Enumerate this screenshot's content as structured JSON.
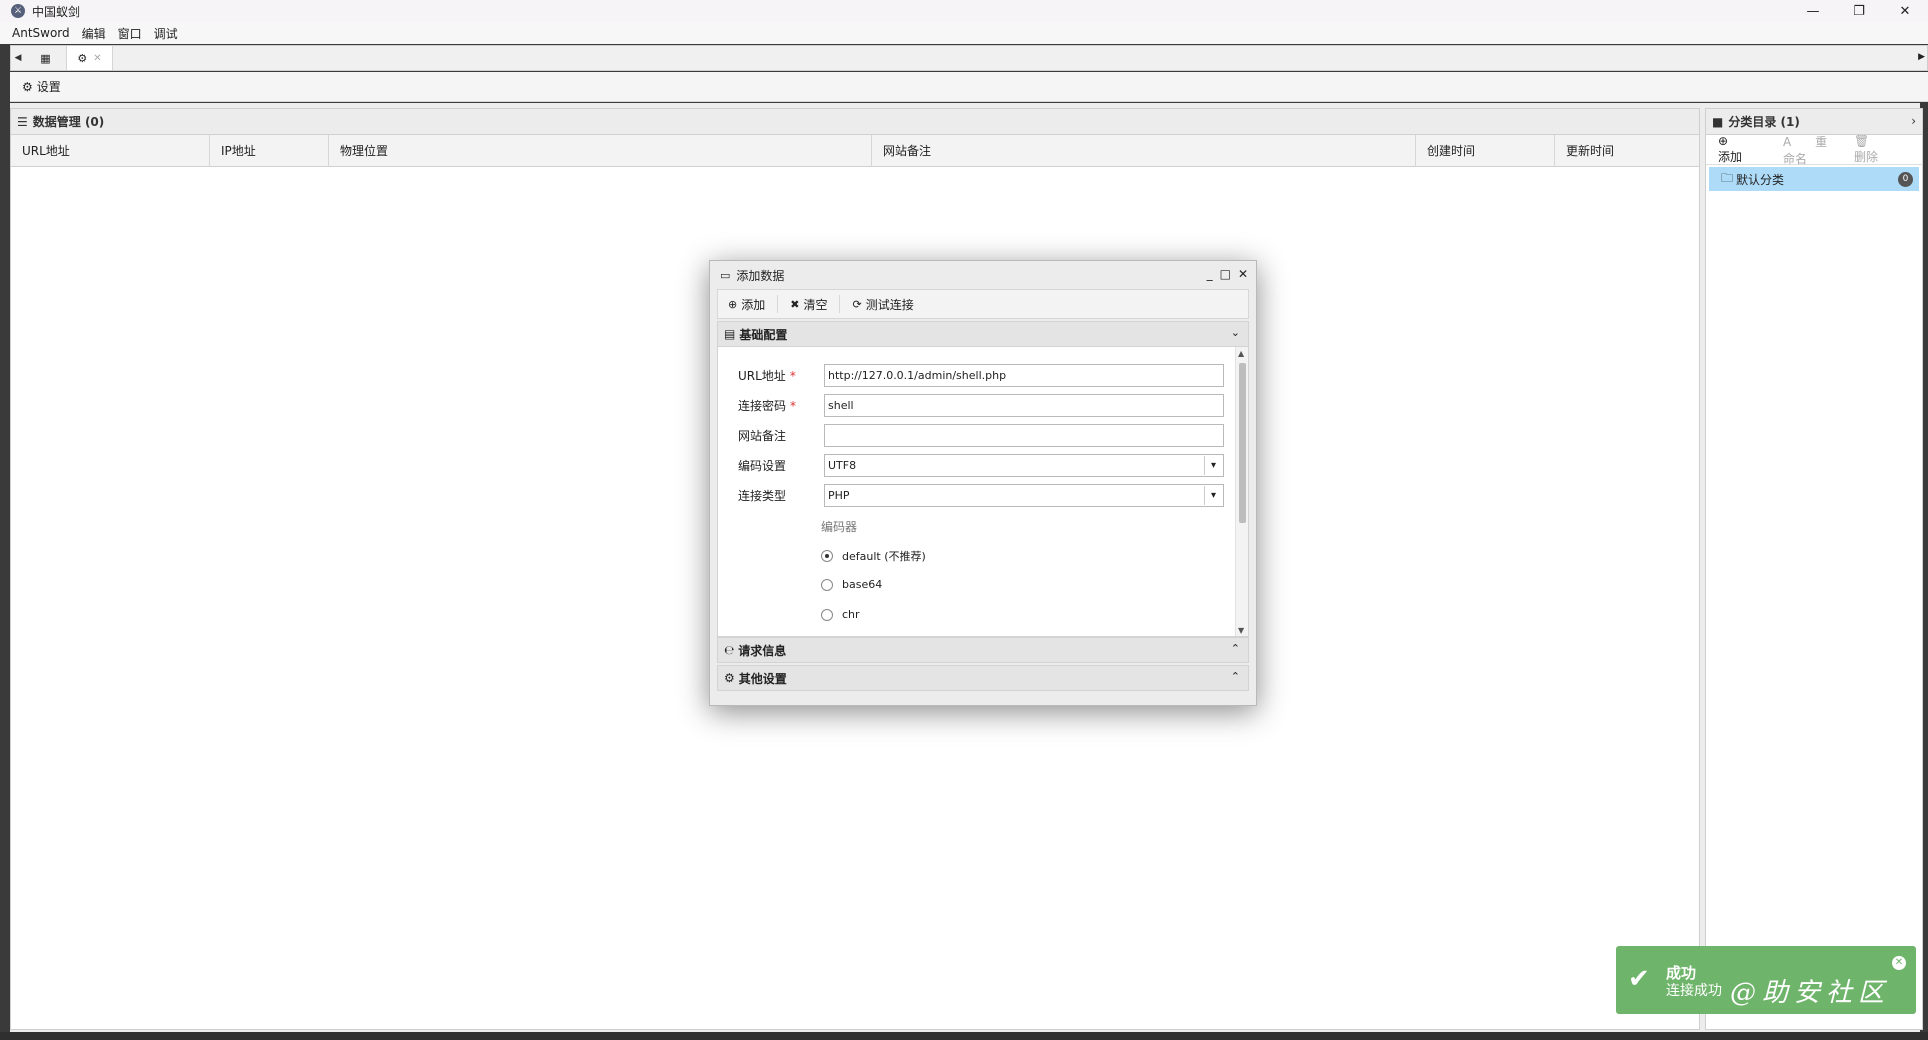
{
  "window": {
    "title": "中国蚁剑",
    "logo_char": "⚔"
  },
  "window_controls": {
    "minimize": "—",
    "maximize": "❐",
    "close": "✕"
  },
  "menu": {
    "items": [
      "AntSword",
      "编辑",
      "窗口",
      "调试"
    ]
  },
  "tabs": {
    "left_arrow": "◀",
    "right_arrow": "▶",
    "home_icon": "▦",
    "settings_icon": "⚙",
    "close": "✕"
  },
  "settings_bar": {
    "icon": "⚙",
    "label": "设置"
  },
  "data_panel": {
    "icon": "☰",
    "title": "数据管理 (0)",
    "columns": [
      "URL地址",
      "IP地址",
      "物理位置",
      "网站备注",
      "创建时间",
      "更新时间"
    ]
  },
  "category_panel": {
    "icon": "■",
    "title": "分类目录 (1)",
    "collapse": "›",
    "toolbar": {
      "add_icon": "⊕",
      "add": "添加",
      "rename_icon": "A",
      "rename": "重命名",
      "delete_icon": "🗑",
      "delete": "删除"
    },
    "items": [
      {
        "icon": "🗀",
        "label": "默认分类",
        "count": "0"
      }
    ]
  },
  "dialog": {
    "icon": "▭",
    "title": "添加数据",
    "controls": {
      "minimize": "_",
      "maximize": "□",
      "close": "✕"
    },
    "toolbar": {
      "add_icon": "⊕",
      "add": "添加",
      "clear_icon": "✖",
      "clear": "清空",
      "test_icon": "⟳",
      "test": "测试连接"
    },
    "sections": {
      "basic": {
        "icon": "▤",
        "title": "基础配置",
        "arrow": "⌄"
      },
      "request": {
        "icon": "℮",
        "title": "请求信息",
        "arrow": "⌃"
      },
      "other": {
        "icon": "⚙",
        "title": "其他设置",
        "arrow": "⌃"
      }
    },
    "form": {
      "url": {
        "label": "URL地址",
        "required": "*",
        "value": "http://127.0.0.1/admin/shell.php"
      },
      "password": {
        "label": "连接密码",
        "required": "*",
        "value": "shell"
      },
      "note": {
        "label": "网站备注",
        "value": ""
      },
      "encoding": {
        "label": "编码设置",
        "value": "UTF8",
        "dropdown": "▾"
      },
      "type": {
        "label": "连接类型",
        "value": "PHP",
        "dropdown": "▾"
      },
      "encoder_label": "编码器",
      "encoders": [
        {
          "label": "default (不推荐)",
          "checked": true
        },
        {
          "label": "base64",
          "checked": false
        },
        {
          "label": "chr",
          "checked": false
        }
      ]
    },
    "scroll": {
      "up": "▲",
      "down": "▼"
    }
  },
  "toast": {
    "check": "✔",
    "title": "成功",
    "message": "连接成功",
    "close": "✕"
  },
  "watermark": "@助安社区"
}
